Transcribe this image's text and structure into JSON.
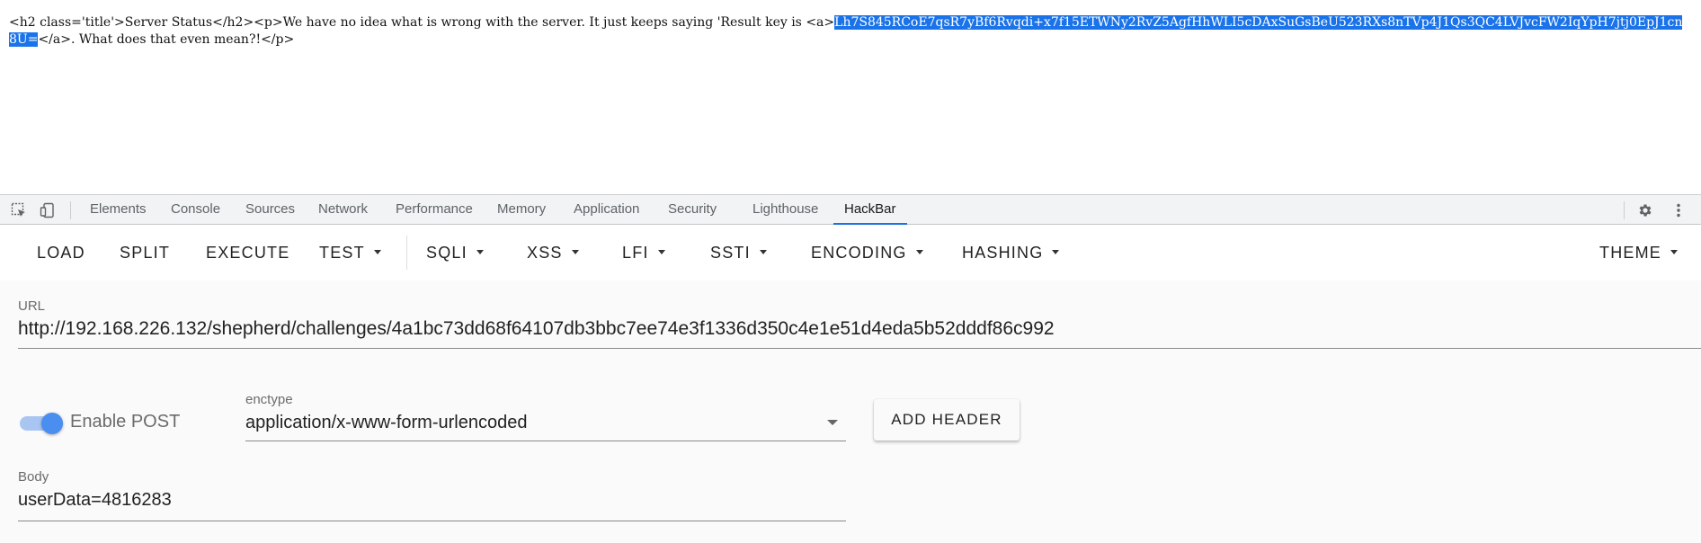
{
  "page": {
    "raw_before": "<h2 class='title'>Server Status</h2><p>We have no idea what is wrong with the server. It just keeps saying 'Result key is <a>",
    "raw_selected": "Lh7S845RCoE7qsR7yBf6Rvqdi+x7f15ETWNy2RvZ5AgfHhWLI5cDAxSuGsBeU523RXs8nTVp4J1Qs3QC4LVJvcFW2IqYpH7jtj0EpJ1cn8U=",
    "raw_after": "</a>. What does that even mean?!</p>"
  },
  "devtools": {
    "tabs": [
      "Elements",
      "Console",
      "Sources",
      "Network",
      "Performance",
      "Memory",
      "Application",
      "Security",
      "Lighthouse",
      "HackBar"
    ],
    "active_tab": "HackBar",
    "accent_color": "#1a73e8"
  },
  "hackbar": {
    "toolbar": {
      "load": "LOAD",
      "split": "SPLIT",
      "execute": "EXECUTE",
      "test": "TEST",
      "sqli": "SQLI",
      "xss": "XSS",
      "lfi": "LFI",
      "ssti": "SSTI",
      "encoding": "ENCODING",
      "hashing": "HASHING",
      "theme": "THEME"
    },
    "url_label": "URL",
    "url_value": "http://192.168.226.132/shepherd/challenges/4a1bc73dd68f64107db3bbc7ee74e3f1336d350c4e1e51d4eda5b52dddf86c992",
    "enable_post_label": "Enable POST",
    "enable_post": true,
    "enctype_label": "enctype",
    "enctype_value": "application/x-www-form-urlencoded",
    "add_header": "ADD HEADER",
    "body_label": "Body",
    "body_value": "userData=4816283"
  }
}
